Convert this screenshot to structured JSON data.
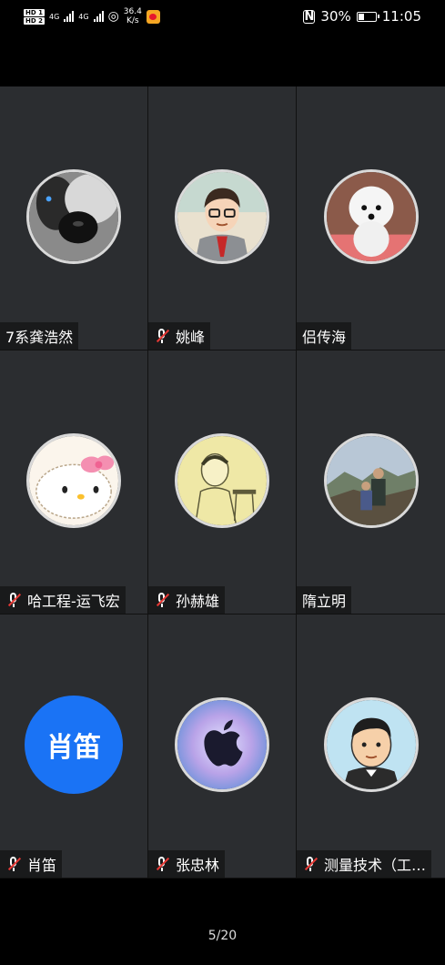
{
  "status_bar": {
    "hd1": "HD 1",
    "hd2": "HD 2",
    "net1": "4G",
    "net2": "4G",
    "speed_value": "36.4",
    "speed_unit": "K/s",
    "battery": "30%",
    "battery_level": 0.3,
    "time": "11:05"
  },
  "participants": [
    {
      "name": "7系龚浩然",
      "muted": false,
      "avatar": "dog-photo"
    },
    {
      "name": "姚峰",
      "muted": true,
      "avatar": "cartoon-man"
    },
    {
      "name": "侣传海",
      "muted": false,
      "avatar": "white-dog"
    },
    {
      "name": "哈工程-运飞宏",
      "muted": true,
      "avatar": "hello-kitty"
    },
    {
      "name": "孙赫雄",
      "muted": true,
      "avatar": "sketch-man"
    },
    {
      "name": "隋立明",
      "muted": false,
      "avatar": "landscape-photo"
    },
    {
      "name": "肖笛",
      "muted": true,
      "avatar_text": "肖笛",
      "avatar_color": "#1a73f5"
    },
    {
      "name": "张忠林",
      "muted": true,
      "avatar": "apple-logo"
    },
    {
      "name": "测量技术（工…",
      "muted": true,
      "avatar": "cartoon-boy"
    }
  ],
  "page_indicator": "5/20"
}
